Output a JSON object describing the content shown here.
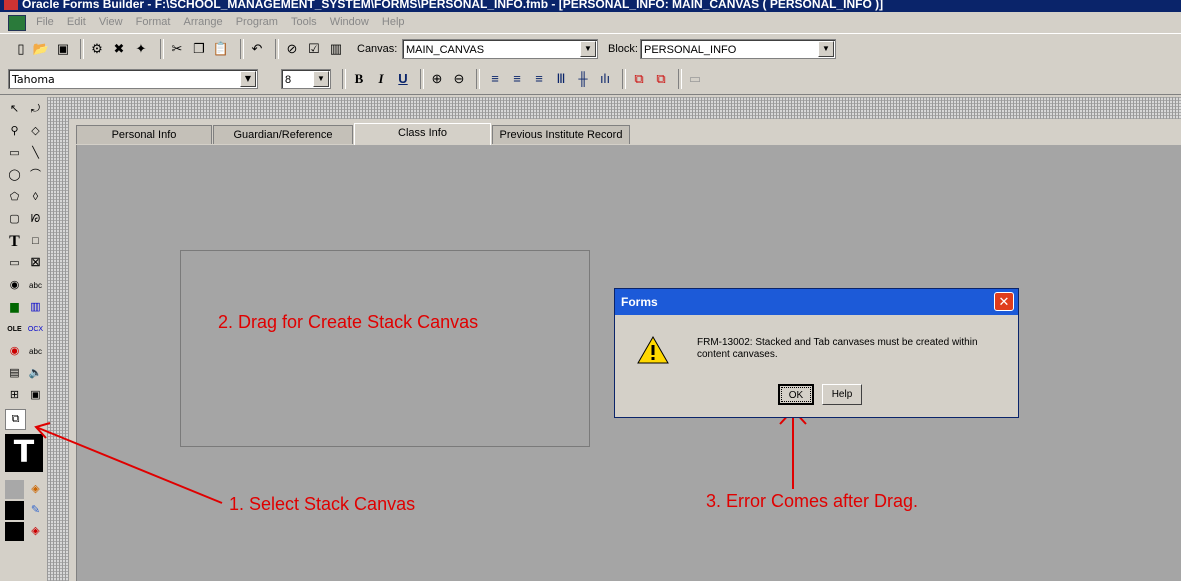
{
  "window": {
    "title": "Oracle Forms Builder - F:\\SCHOOL_MANAGEMENT_SYSTEM\\FORMS\\PERSONAL_INFO.fmb - [PERSONAL_INFO: MAIN_CANVAS ( PERSONAL_INFO )]"
  },
  "menu": {
    "items": [
      "File",
      "Edit",
      "View",
      "Format",
      "Arrange",
      "Program",
      "Tools",
      "Window",
      "Help"
    ]
  },
  "toolbar": {
    "canvas_label": "Canvas:",
    "canvas_value": "MAIN_CANVAS",
    "block_label": "Block:",
    "block_value": "PERSONAL_INFO"
  },
  "format_bar": {
    "font_name": "Tahoma",
    "font_size": "8",
    "bold": "B",
    "italic": "I",
    "underline": "U"
  },
  "tabs": [
    {
      "label": "Personal Info"
    },
    {
      "label": "Guardian/Reference"
    },
    {
      "label": "Class Info",
      "active": true
    },
    {
      "label": "Previous Institute Record"
    }
  ],
  "annotations": {
    "step1": "1. Select Stack Canvas",
    "step2": "2. Drag for Create Stack Canvas",
    "step3": "3. Error Comes after Drag."
  },
  "dialog": {
    "title": "Forms",
    "message": "FRM-13002: Stacked and Tab canvases must be created within content canvases.",
    "ok_label": "OK",
    "help_label": "Help"
  },
  "colors": {
    "annotation": "#e00000",
    "dialog_title": "#1c5ad8",
    "workarea": "#a5a5a5"
  }
}
